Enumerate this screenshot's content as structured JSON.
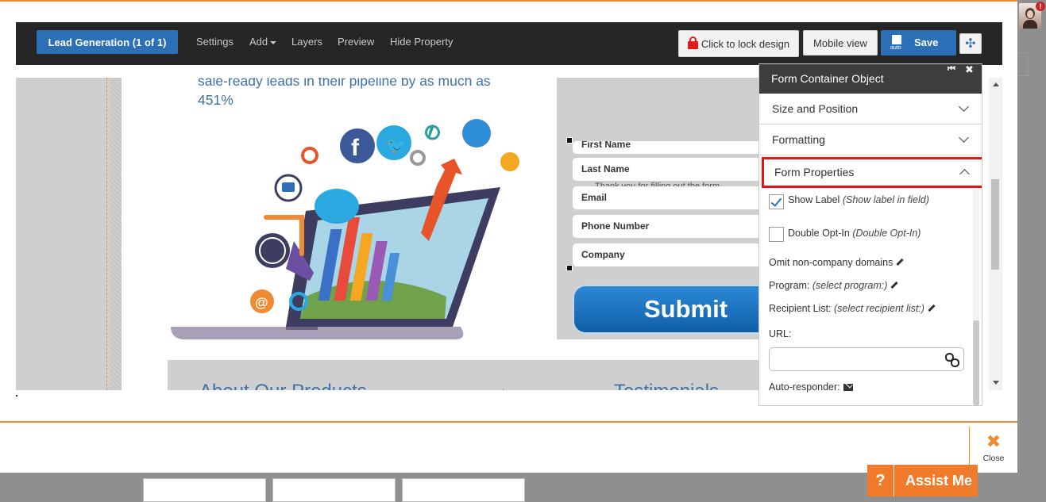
{
  "toolbar": {
    "lead_gen_label": "Lead Generation  (1 of 1)",
    "links": [
      "Settings",
      "Add",
      "Layers",
      "Preview",
      "Hide Property"
    ],
    "lock_label": "Click to lock design",
    "mobile_label": "Mobile view",
    "save_label": "Save",
    "save_sub": "auto",
    "accent": "#2b6fb6"
  },
  "canvas": {
    "headline": "sale-ready leads in their pipeline by as much as 451%",
    "band_left": "About Our Products",
    "band_right": "Testimonials",
    "form": {
      "fields": [
        "First Name",
        "Last Name",
        "Email",
        "Phone Number",
        "Company"
      ],
      "ghost_text": "Thank you for filling out the form",
      "submit_label": "Submit"
    }
  },
  "panel": {
    "title": "Form Container Object",
    "sections": [
      "Size and Position",
      "Formatting",
      "Form Properties"
    ],
    "show_label": "Show Label",
    "show_label_hint": "(Show label in field)",
    "show_label_checked": true,
    "double_optin": "Double Opt-In",
    "double_optin_hint": "(Double Opt-In)",
    "double_optin_checked": false,
    "omit_domains": "Omit non-company domains",
    "program_label": "Program:",
    "program_value": "(select program:)",
    "recipient_label": "Recipient List:",
    "recipient_value": "(select recipient list:)",
    "url_label": "URL:",
    "url_value": "",
    "autoresponder_label": "Auto-responder:",
    "highlight_color": "#e31414"
  },
  "footer": {
    "close_label": "Close",
    "assist_label": "Assist Me",
    "assist_icon": "?",
    "brand_orange": "#f08b34"
  },
  "user": {
    "notification_count": "!"
  }
}
